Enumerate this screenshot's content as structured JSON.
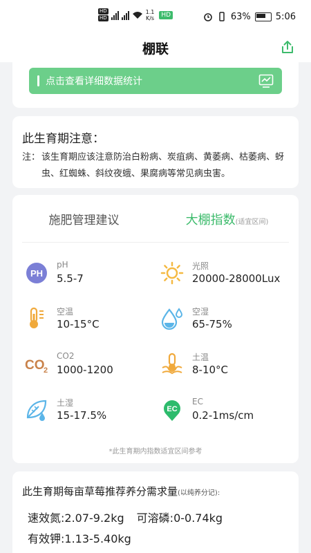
{
  "status_bar": {
    "speed": "1.1",
    "speed_unit": "K/s",
    "network_badge": "HD",
    "battery_percent": "63%",
    "time": "5:06"
  },
  "nav": {
    "title": "棚联"
  },
  "stats_button": {
    "label": "点击查看详细数据统计"
  },
  "notice": {
    "title": "此生育期注意：",
    "prefix": "注：",
    "text": "该生育期应该注意防治白粉病、炭疽病、黄萎病、枯萎病、蚜虫、红蜘蛛、斜纹夜蛾、果腐病等常见病虫害。"
  },
  "tabs": {
    "fertilizer": "施肥管理建议",
    "index": "大棚指数",
    "index_note": "(适宜区间)"
  },
  "indices": [
    {
      "label": "pH",
      "value": "5.5-7",
      "icon": "ph-icon"
    },
    {
      "label": "光照",
      "value": "20000-28000Lux",
      "icon": "sun-icon"
    },
    {
      "label": "空温",
      "value": "10-15°C",
      "icon": "thermometer-icon"
    },
    {
      "label": "空湿",
      "value": "65-75%",
      "icon": "water-drop-icon"
    },
    {
      "label": "CO2",
      "value": "1000-1200",
      "icon": "co2-icon"
    },
    {
      "label": "土温",
      "value": "8-10°C",
      "icon": "soil-temperature-icon"
    },
    {
      "label": "土湿",
      "value": "15-17.5%",
      "icon": "soil-moisture-icon"
    },
    {
      "label": "EC",
      "value": "0.2-1ms/cm",
      "icon": "ec-icon"
    }
  ],
  "index_footnote": "*此生育期内指数适宜区间参考",
  "nutrient": {
    "title": "此生育期每亩草莓推荐养分需求量",
    "title_note": "(以纯养分记):",
    "n_label": "速效氮:2.07-9.2kg",
    "p_label": "可溶磷:0-0.74kg",
    "k_label": "有效钾:1.13-5.40kg"
  },
  "colors": {
    "accent": "#3dbb6c",
    "button": "#6ccf8a",
    "ph": "#7b7fd6",
    "sun": "#f5b942",
    "thermo": "#f0a93b",
    "drop": "#5bb5e8",
    "co2": "#c9824a",
    "ec": "#2dbb6c"
  }
}
